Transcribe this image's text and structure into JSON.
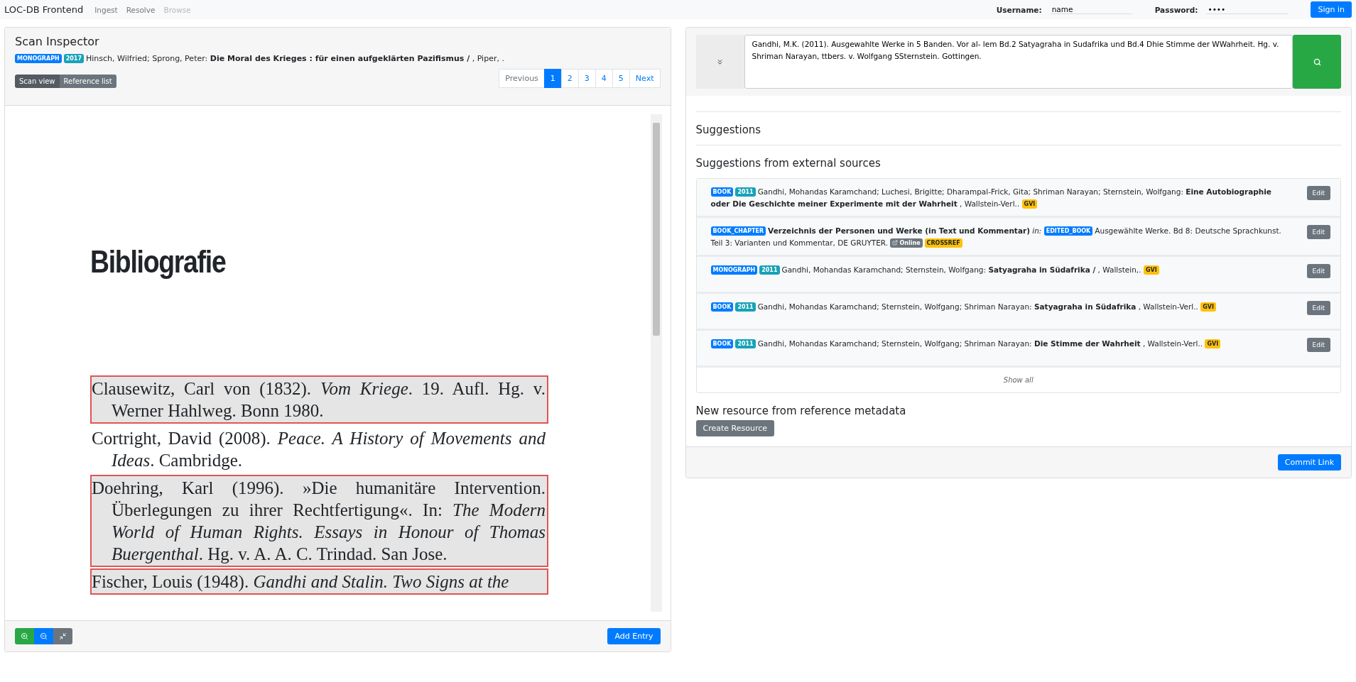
{
  "navbar": {
    "brand": "LOC-DB Frontend",
    "links": [
      {
        "label": "Ingest",
        "disabled": false
      },
      {
        "label": "Resolve",
        "disabled": false
      },
      {
        "label": "Browse",
        "disabled": true
      }
    ],
    "login": {
      "username_label": "Username:",
      "username": "name",
      "password_label": "Password:",
      "password": "••••",
      "button": "Sign in"
    }
  },
  "scan_inspector": {
    "title": "Scan Inspector",
    "resource": [
      {
        "kind": "type",
        "text": "MONOGRAPH"
      },
      {
        "kind": "year",
        "text": "2017"
      },
      {
        "kind": "text",
        "text": "Hinsch, Wilfried; Sprong, Peter: **Die Moral des Krieges : für einen aufgeklärten Pazifismus /** , Piper, ."
      }
    ],
    "views": [
      {
        "label": "Scan view",
        "selected": true
      },
      {
        "label": "Reference list",
        "selected": false
      }
    ],
    "pagination": [
      {
        "label": "Previous",
        "selected": false
      },
      {
        "label": "1",
        "selected": true
      },
      {
        "label": "2",
        "selected": false
      },
      {
        "label": "3",
        "selected": false
      },
      {
        "label": "4",
        "selected": false
      },
      {
        "label": "5",
        "selected": false
      },
      {
        "label": "Next",
        "selected": false
      }
    ],
    "scan": {
      "heading": "Bibliografie",
      "entries": [
        {
          "text": "Clausewitz, Carl von (1832). *Vom Kriege*. 19. Aufl. Hg. v. Werner Hahlweg. Bonn 1980.",
          "highlighted": true
        },
        {
          "text": "Cortright, David (2008). *Peace. A History of Movements and Ideas*. Cambridge.",
          "highlighted": false
        },
        {
          "text": "Doehring, Karl (1996). »Die humanitäre Intervention. Überlegungen zu ihrer Rechtfertigung«. In: *The Modern World of Human Rights. Essays in Honour of Thomas Buergenthal*. Hg. v. A. A. C. Trindad. San Jose.",
          "highlighted": true
        },
        {
          "text": "Fischer, Louis (1948). *Gandhi and Stalin. Two Signs at the*",
          "highlighted": true
        }
      ]
    },
    "footer": {
      "add_button": "Add Entry"
    }
  },
  "resolver": {
    "reference_text": "Gandhi, M.K. (2011). Ausgewahlte Werke in 5 Banden. Vor al- lem Bd.2 Satyagraha in Sudafrika und Bd.4 Dhie Stimme der WWahrheit. Hg. v. Shriman Narayan, ttbers. v. Wolfgang SSternstein. Gottingen.",
    "suggestions_heading": "Suggestions",
    "external_heading": "Suggestions from external sources",
    "external": [
      {
        "parts": [
          {
            "kind": "type",
            "text": "BOOK"
          },
          {
            "kind": "year",
            "text": "2011"
          },
          {
            "kind": "text",
            "text": "Gandhi, Mohandas Karamchand; Luchesi, Brigitte; Dharampal-Frick, Gita; Shriman Narayan; Sternstein, Wolfgang: **Eine Autobiographie oder Die Geschichte meiner Experimente mit der Wahrheit** , Wallstein-Verl.."
          },
          {
            "kind": "source",
            "text": "GVI"
          }
        ],
        "button": "Edit"
      },
      {
        "parts": [
          {
            "kind": "type",
            "text": "BOOK_CHAPTER"
          },
          {
            "kind": "text",
            "text": "**Verzeichnis der Personen und Werke (in Text und Kommentar)** *in:*"
          },
          {
            "kind": "type",
            "text": "EDITED_BOOK"
          },
          {
            "kind": "text",
            "text": "Ausgewählte Werke. Bd 8: Deutsche Sprachkunst. Teil 3: Varianten und Kommentar, DE GRUYTER."
          },
          {
            "kind": "online",
            "text": "Online"
          },
          {
            "kind": "source",
            "text": "CROSSREF"
          }
        ],
        "button": "Edit"
      },
      {
        "parts": [
          {
            "kind": "type",
            "text": "MONOGRAPH"
          },
          {
            "kind": "year",
            "text": "2011"
          },
          {
            "kind": "text",
            "text": "Gandhi, Mohandas Karamchand; Sternstein, Wolfgang: **Satyagraha in Südafrika /** , Wallstein,."
          },
          {
            "kind": "source",
            "text": "GVI"
          }
        ],
        "button": "Edit"
      },
      {
        "parts": [
          {
            "kind": "type",
            "text": "BOOK"
          },
          {
            "kind": "year",
            "text": "2011"
          },
          {
            "kind": "text",
            "text": "Gandhi, Mohandas Karamchand; Sternstein, Wolfgang; Shriman Narayan: **Satyagraha in Südafrika** , Wallstein-Verl.."
          },
          {
            "kind": "source",
            "text": "GVI"
          }
        ],
        "button": "Edit"
      },
      {
        "parts": [
          {
            "kind": "type",
            "text": "BOOK"
          },
          {
            "kind": "year",
            "text": "2011"
          },
          {
            "kind": "text",
            "text": "Gandhi, Mohandas Karamchand; Sternstein, Wolfgang; Shriman Narayan: **Die Stimme der Wahrheit** , Wallstein-Verl.."
          },
          {
            "kind": "source",
            "text": "GVI"
          }
        ],
        "button": "Edit"
      }
    ],
    "show_all": "Show all",
    "new_heading": "New resource from reference metadata",
    "create_button": "Create Resource",
    "commit_button": "Commit Link"
  }
}
